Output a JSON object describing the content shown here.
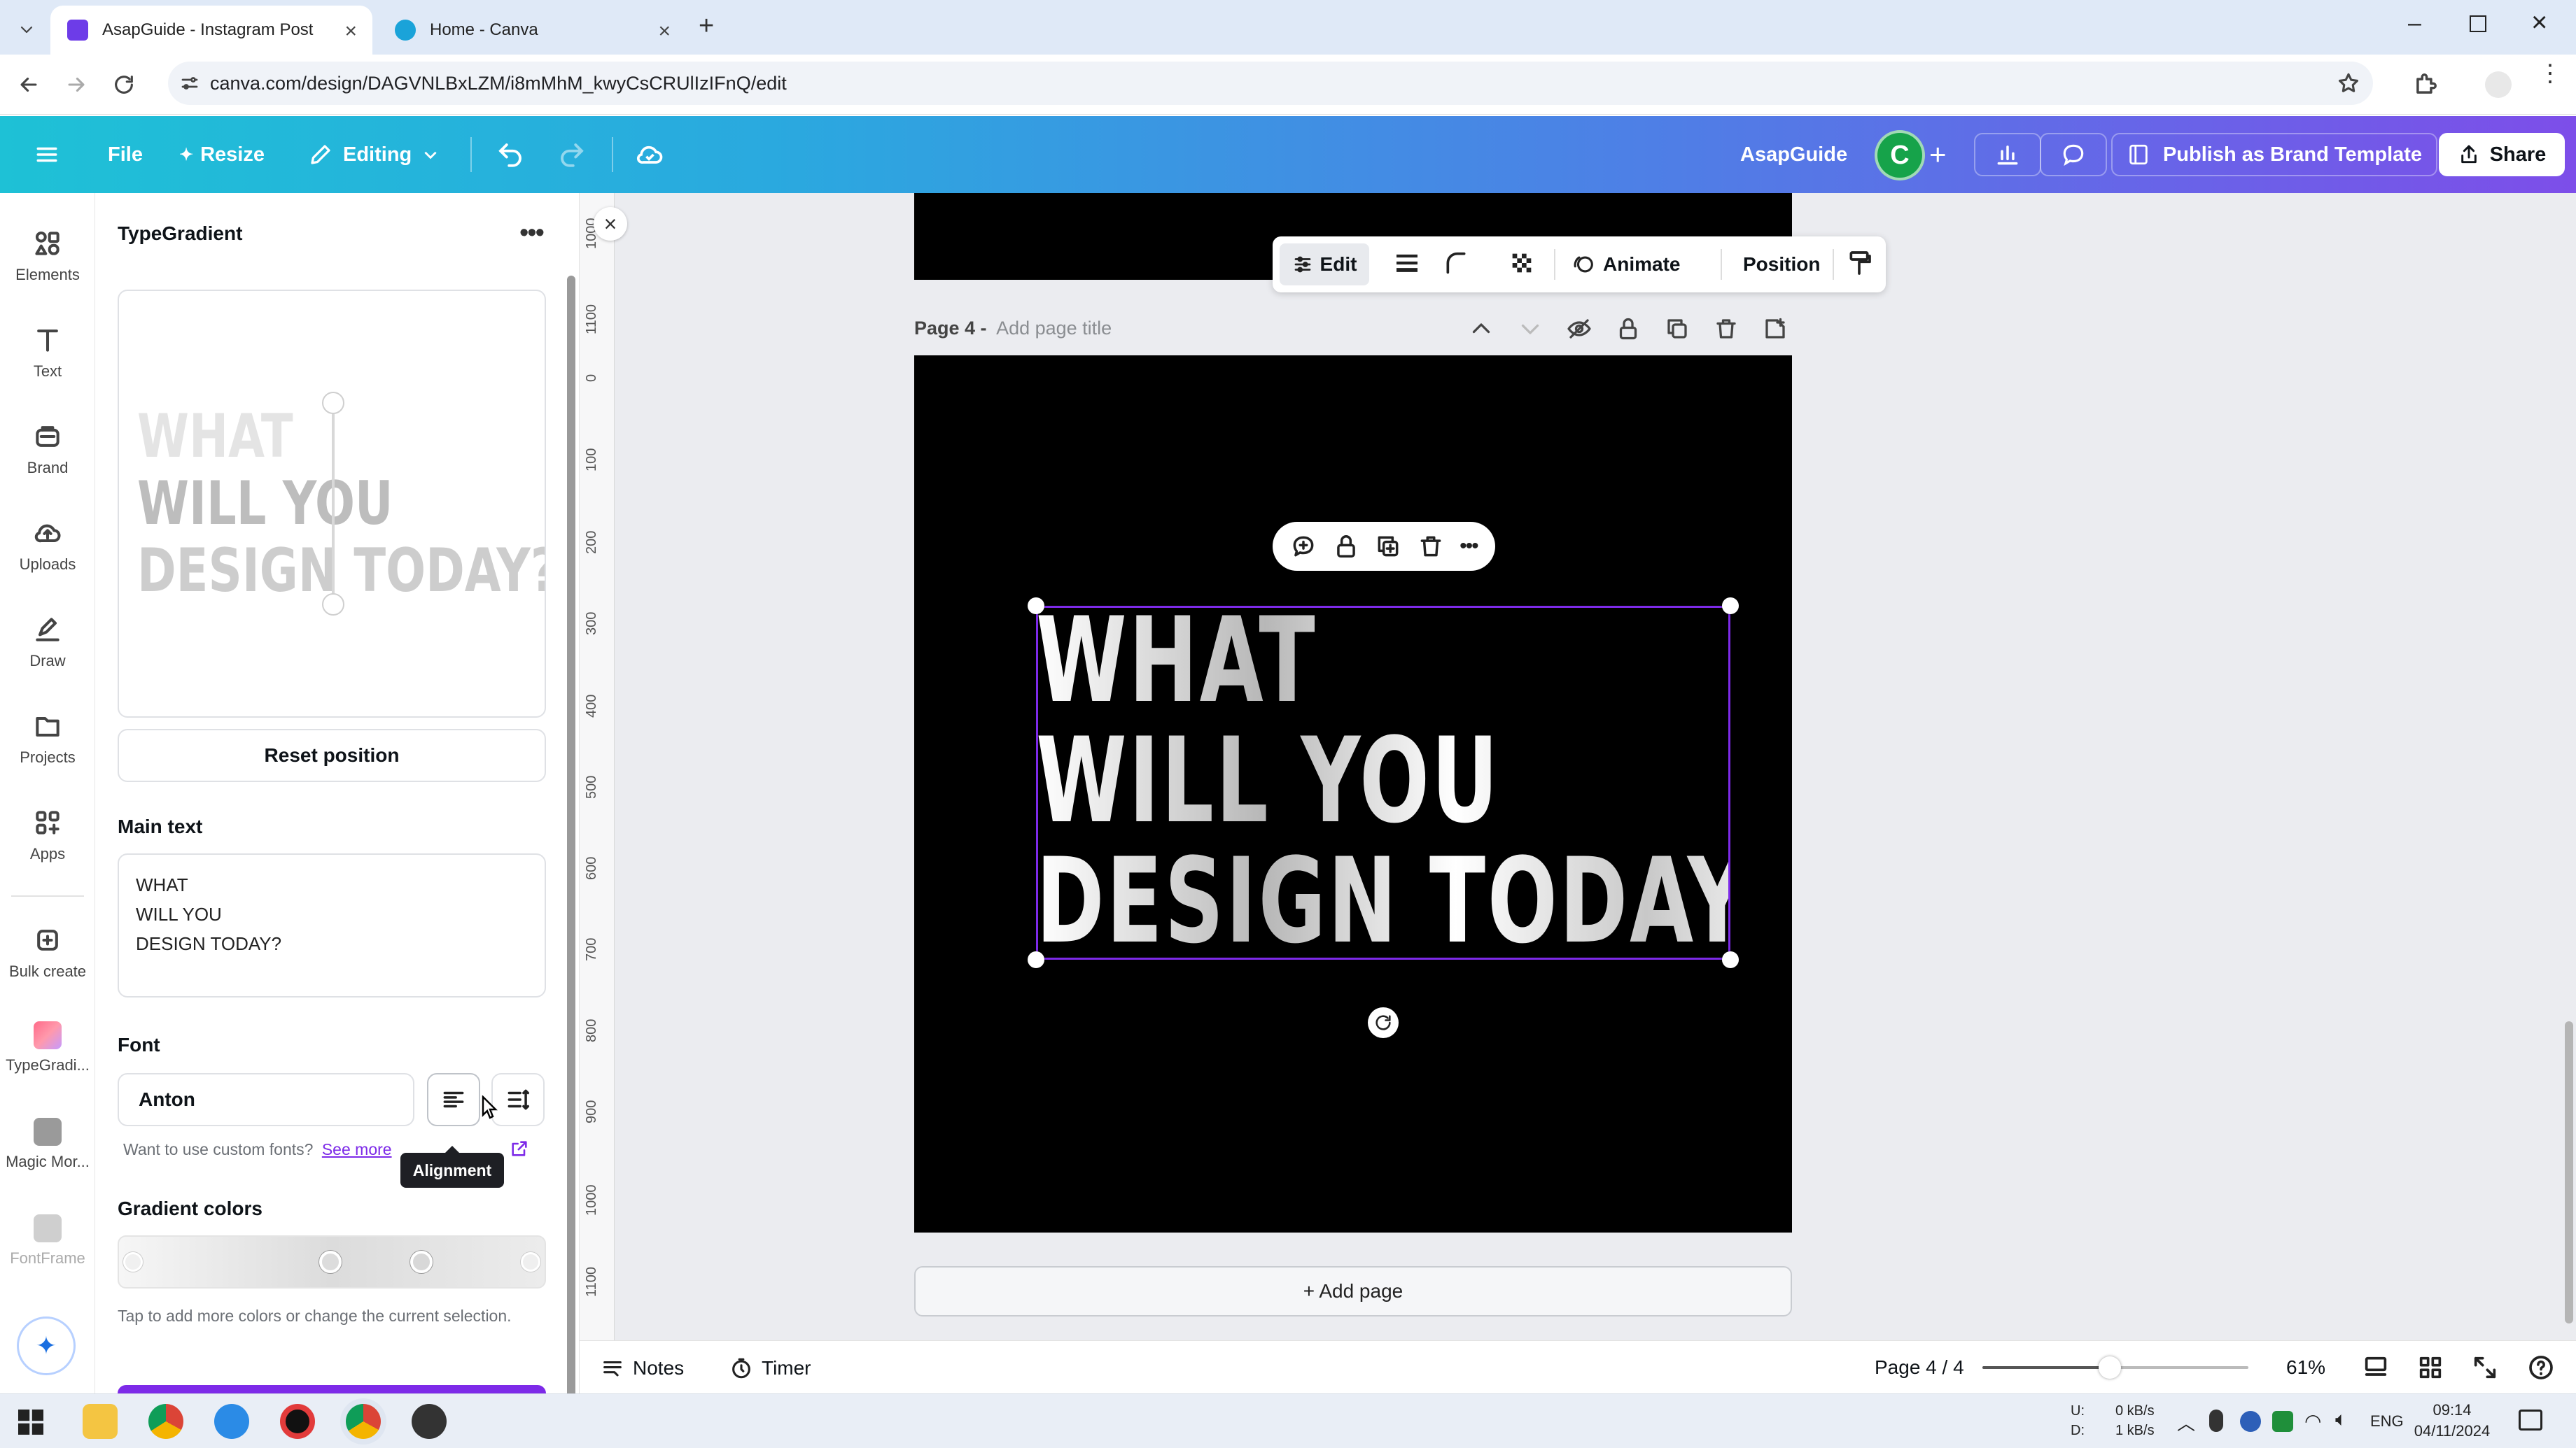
{
  "browser": {
    "tabs": [
      {
        "title": "AsapGuide - Instagram Post",
        "active": true
      },
      {
        "title": "Home - Canva",
        "active": false
      }
    ],
    "url": "canva.com/design/DAGVNLBxLZM/i8mMhM_kwyCsCRUlIzIFnQ/edit"
  },
  "topbar": {
    "file": "File",
    "resize": "Resize",
    "editing": "Editing",
    "brand_name": "AsapGuide",
    "avatar_letter": "C",
    "publish": "Publish as Brand Template",
    "share": "Share"
  },
  "rail": [
    {
      "label": "Elements",
      "icon": "elements-icon"
    },
    {
      "label": "Text",
      "icon": "text-icon"
    },
    {
      "label": "Brand",
      "icon": "brand-icon"
    },
    {
      "label": "Uploads",
      "icon": "uploads-icon"
    },
    {
      "label": "Draw",
      "icon": "draw-icon"
    },
    {
      "label": "Projects",
      "icon": "projects-icon"
    },
    {
      "label": "Apps",
      "icon": "apps-icon"
    },
    {
      "label": "Bulk create",
      "icon": "bulk-create-icon"
    },
    {
      "label": "TypeGradi...",
      "icon": "typegradient-icon"
    },
    {
      "label": "Magic Mor...",
      "icon": "magic-morph-icon"
    },
    {
      "label": "FontFrame",
      "icon": "fontframe-icon"
    }
  ],
  "panel": {
    "title": "TypeGradient",
    "preview_lines": [
      "WHAT",
      "WILL YOU",
      "DESIGN TODAY?"
    ],
    "reset": "Reset position",
    "main_text_label": "Main text",
    "main_text_lines": [
      "WHAT",
      "WILL YOU",
      "DESIGN TODAY?"
    ],
    "font_label": "Font",
    "font_value": "Anton",
    "custom_fonts_text": "Want to use custom fonts?",
    "see_more": "See more",
    "tooltip": "Alignment",
    "gradient_label": "Gradient colors",
    "gradient_hint": "Tap to add more colors or change the current selection."
  },
  "toolbar": {
    "edit": "Edit",
    "animate": "Animate",
    "position": "Position"
  },
  "page": {
    "label": "Page 4 -",
    "title_placeholder": "Add page title",
    "text_lines": [
      "WHAT",
      "WILL YOU",
      "DESIGN TODAY?"
    ],
    "add_page": "+ Add page"
  },
  "ruler_ticks": [
    "1000",
    "1100",
    "0",
    "100",
    "200",
    "300",
    "400",
    "500",
    "600",
    "700",
    "800",
    "900",
    "1000",
    "1100"
  ],
  "bottom": {
    "notes": "Notes",
    "timer": "Timer",
    "page_count": "Page 4 / 4",
    "zoom": "61%",
    "zoom_level": 0.61
  },
  "taskbar": {
    "net_up": "0 kB/s",
    "net_down": "1 kB/s",
    "net_u": "U:",
    "net_d": "D:",
    "lang": "ENG",
    "time": "09:14",
    "date": "04/11/2024"
  },
  "colors": {
    "accent": "#7d2ae8",
    "topbar_start": "#1ec1d6",
    "topbar_end": "#7d4ee9",
    "avatar": "#16a34a",
    "canvas_bg": "#000000"
  }
}
